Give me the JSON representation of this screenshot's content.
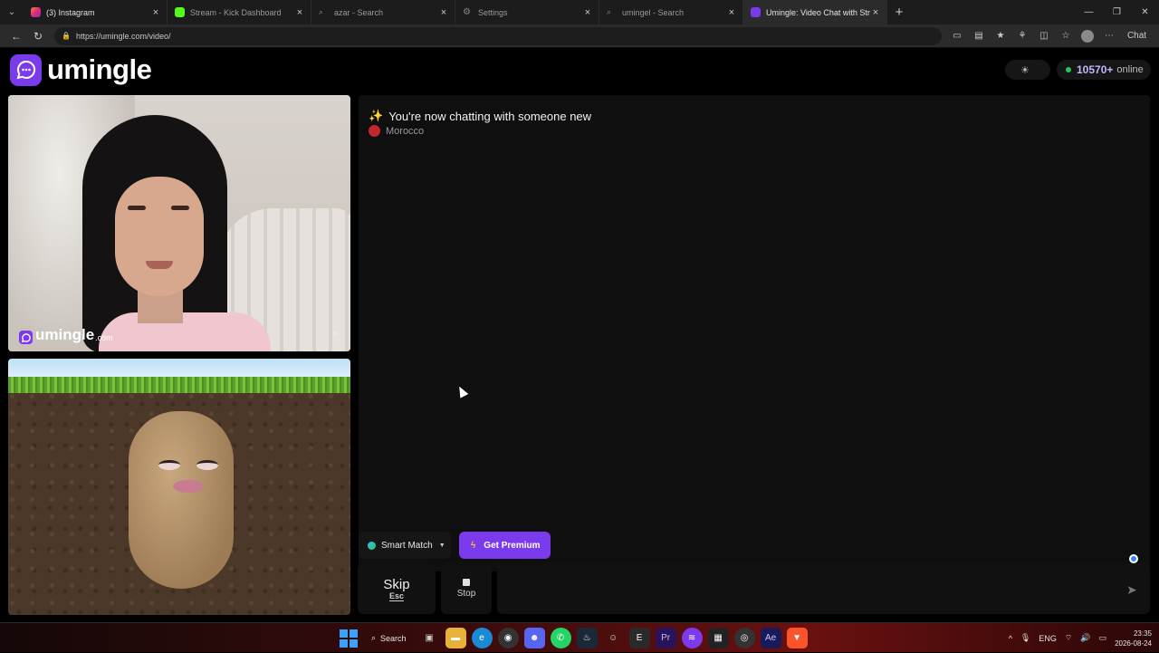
{
  "browser": {
    "tabs": [
      {
        "label": "(3) Instagram",
        "color": "#e1306c",
        "active": false
      },
      {
        "label": "Stream - Kick Dashboard",
        "color": "#53fc18",
        "active": false
      },
      {
        "label": "azar - Search",
        "color": "#555555",
        "active": false
      },
      {
        "label": "Settings",
        "color": "#777777",
        "active": false
      },
      {
        "label": "umingel - Search",
        "color": "#555555",
        "active": false
      },
      {
        "label": "Umingle: Video Chat with Stra",
        "color": "#7c3aed",
        "active": true
      }
    ],
    "url": "https://umingle.com/video/",
    "copilot_label": "Chat"
  },
  "site": {
    "logo_text": "umingle",
    "online_count": "10570+",
    "online_label": "online",
    "watermark_text": "umingle",
    "watermark_domain": ".com"
  },
  "chat": {
    "status_message": "You're now chatting with someone new",
    "country": "Morocco",
    "country_color": "#c1272d"
  },
  "controls": {
    "match_mode": "Smart Match",
    "premium_label": "Get Premium",
    "skip_label": "Skip",
    "skip_key": "Esc",
    "stop_label": "Stop",
    "message_placeholder": ""
  },
  "taskbar": {
    "search_label": "Search",
    "language": "ENG",
    "time": "23:35",
    "date": "2026-08-24"
  },
  "colors": {
    "accent": "#7c3aed",
    "online": "#22c55e"
  }
}
